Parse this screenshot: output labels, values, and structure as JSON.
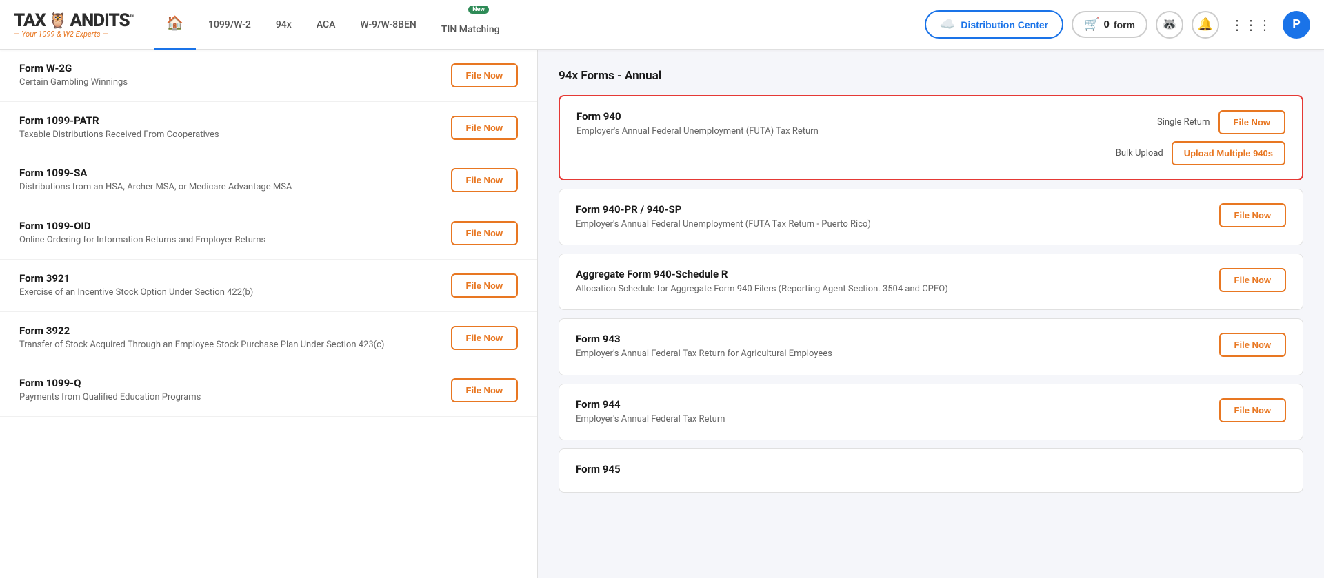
{
  "logo": {
    "text_tax": "TAX",
    "text_andits": "ANDITS",
    "tm": "™",
    "tagline": "— Your 1099 & W2 Experts —"
  },
  "nav": {
    "items": [
      {
        "id": "home",
        "label": "",
        "icon": "🏠",
        "active": true
      },
      {
        "id": "1099w2",
        "label": "1099/W-2",
        "icon": "",
        "active": false
      },
      {
        "id": "94x",
        "label": "94x",
        "icon": "",
        "active": false
      },
      {
        "id": "aca",
        "label": "ACA",
        "icon": "",
        "active": false
      },
      {
        "id": "w9",
        "label": "W-9/W-8BEN",
        "icon": "",
        "active": false
      },
      {
        "id": "tin",
        "label": "TIN Matching",
        "icon": "",
        "badge": "New",
        "active": false
      }
    ]
  },
  "header": {
    "dist_center_label": "Distribution Center",
    "cart_label": "form",
    "cart_count": "0",
    "avatar_letter": "P"
  },
  "left_panel": {
    "forms": [
      {
        "name": "Form W-2G",
        "desc": "Certain Gambling Winnings",
        "btn": "File Now"
      },
      {
        "name": "Form 1099-PATR",
        "desc": "Taxable Distributions Received From Cooperatives",
        "btn": "File Now"
      },
      {
        "name": "Form 1099-SA",
        "desc": "Distributions from an HSA, Archer MSA, or Medicare Advantage MSA",
        "btn": "File Now"
      },
      {
        "name": "Form 1099-OID",
        "desc": "Online Ordering for Information Returns and Employer Returns",
        "btn": "File Now"
      },
      {
        "name": "Form 3921",
        "desc": "Exercise of an Incentive Stock Option Under Section 422(b)",
        "btn": "File Now"
      },
      {
        "name": "Form 3922",
        "desc": "Transfer of Stock Acquired Through an Employee Stock Purchase Plan Under Section 423(c)",
        "btn": "File Now"
      },
      {
        "name": "Form 1099-Q",
        "desc": "Payments from Qualified Education Programs",
        "btn": "File Now"
      }
    ]
  },
  "right_panel": {
    "section_title": "94x Forms - Annual",
    "cards": [
      {
        "id": "form940",
        "name": "Form 940",
        "desc": "Employer's Annual Federal Unemployment (FUTA) Tax Return",
        "highlighted": true,
        "single_return_label": "Single Return",
        "single_return_btn": "File Now",
        "bulk_upload_label": "Bulk Upload",
        "bulk_upload_btn": "Upload Multiple 940s"
      },
      {
        "id": "form940pr",
        "name": "Form 940-PR / 940-SP",
        "desc": "Employer's Annual Federal Unemployment (FUTA Tax Return - Puerto Rico)",
        "highlighted": false,
        "single_return_label": "",
        "single_return_btn": "File Now",
        "bulk_upload_label": "",
        "bulk_upload_btn": ""
      },
      {
        "id": "agg940",
        "name": "Aggregate Form 940-Schedule R",
        "desc": "Allocation Schedule for Aggregate Form 940 Filers (Reporting Agent Section. 3504 and CPEO)",
        "highlighted": false,
        "single_return_label": "",
        "single_return_btn": "File Now",
        "bulk_upload_label": "",
        "bulk_upload_btn": ""
      },
      {
        "id": "form943",
        "name": "Form 943",
        "desc": "Employer's Annual Federal Tax Return for Agricultural Employees",
        "highlighted": false,
        "single_return_label": "",
        "single_return_btn": "File Now",
        "bulk_upload_label": "",
        "bulk_upload_btn": ""
      },
      {
        "id": "form944",
        "name": "Form 944",
        "desc": "Employer's Annual Federal Tax Return",
        "highlighted": false,
        "single_return_label": "",
        "single_return_btn": "File Now",
        "bulk_upload_label": "",
        "bulk_upload_btn": ""
      },
      {
        "id": "form945",
        "name": "Form 945",
        "desc": "",
        "highlighted": false,
        "single_return_label": "",
        "single_return_btn": "",
        "bulk_upload_label": "",
        "bulk_upload_btn": ""
      }
    ]
  }
}
